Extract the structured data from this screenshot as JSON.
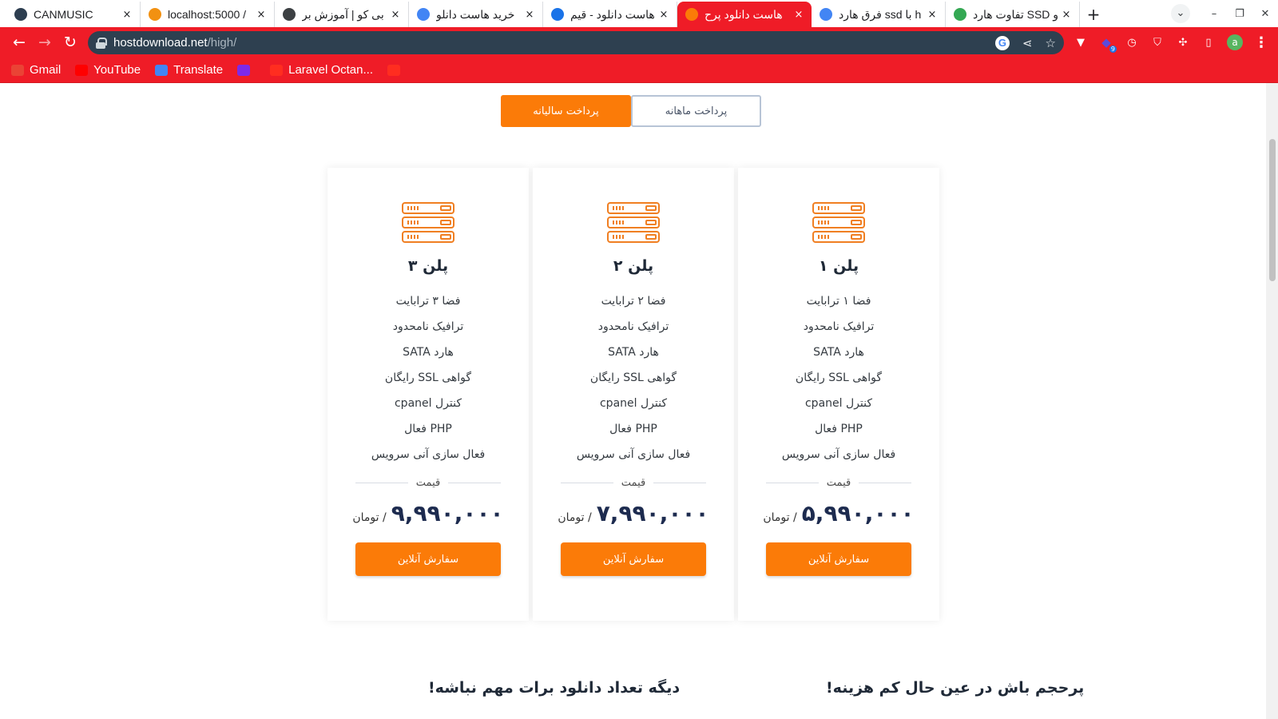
{
  "browser": {
    "tabs": [
      {
        "title": "CANMUSIC",
        "favicon_color": "#2d3e50",
        "active": false
      },
      {
        "title": "localhost:5000 /",
        "favicon_color": "#f29111",
        "active": false
      },
      {
        "title": "بی کو | آموزش بر",
        "favicon_color": "#3c4043",
        "active": false
      },
      {
        "title": "خرید هاست دانلو",
        "favicon_color": "#4285f4",
        "active": false
      },
      {
        "title": "هاست دانلود - قیم",
        "favicon_color": "#1a73e8",
        "active": false
      },
      {
        "title": "هاست دانلود پرح",
        "favicon_color": "#fb7b08",
        "active": true
      },
      {
        "title": "فرق هارد ssd با h",
        "favicon_color": "#4285f4",
        "active": false
      },
      {
        "title": "تفاوت هارد SSD و",
        "favicon_color": "#34a853",
        "active": false
      }
    ],
    "new_tab_label": "+",
    "close_label": "×",
    "url_host": "hostdownload.net",
    "url_path": "/high/",
    "bookmarks": [
      {
        "label": "Gmail",
        "icon": "gmail-icon",
        "color": "#ea4335"
      },
      {
        "label": "YouTube",
        "icon": "youtube-icon",
        "color": "#ff0000"
      },
      {
        "label": "Translate",
        "icon": "translate-icon",
        "color": "#4285f4"
      },
      {
        "label": "",
        "icon": "canva-icon",
        "color": "#7d2ae8"
      },
      {
        "label": "Laravel Octan...",
        "icon": "laravel-icon",
        "color": "#ff2d20"
      },
      {
        "label": "",
        "icon": "laravel-icon",
        "color": "#ff2d20"
      }
    ],
    "extension_badge": "9",
    "avatar_letter": "a"
  },
  "billing_toggle": {
    "yearly": "پرداخت سالیانه",
    "monthly": "پرداخت ماهانه",
    "selected": "yearly"
  },
  "plans": [
    {
      "title": "پلن ۳",
      "features": [
        "فضا ۳ ترابایت",
        "ترافیک نامحدود",
        "هارد SATA",
        "گواهی SSL رایگان",
        "کنترل cpanel",
        "PHP فعال",
        "فعال سازی آنی سرویس"
      ],
      "price_label": "قیمت",
      "price": "۹,۹۹۰,۰۰۰",
      "currency": "/ تومان",
      "order_label": "سفارش آنلاین"
    },
    {
      "title": "پلن ۲",
      "features": [
        "فضا ۲ ترابایت",
        "ترافیک نامحدود",
        "هارد SATA",
        "گواهی SSL رایگان",
        "کنترل cpanel",
        "PHP فعال",
        "فعال سازی آنی سرویس"
      ],
      "price_label": "قیمت",
      "price": "۷,۹۹۰,۰۰۰",
      "currency": "/ تومان",
      "order_label": "سفارش آنلاین"
    },
    {
      "title": "پلن ۱",
      "features": [
        "فضا ۱ ترابایت",
        "ترافیک نامحدود",
        "هارد SATA",
        "گواهی SSL رایگان",
        "کنترل cpanel",
        "PHP فعال",
        "فعال سازی آنی سرویس"
      ],
      "price_label": "قیمت",
      "price": "۵,۹۹۰,۰۰۰",
      "currency": "/ تومان",
      "order_label": "سفارش آنلاین"
    }
  ],
  "bottom": {
    "left_heading": "دیگه تعداد دانلود برات مهم نباشه!",
    "right_heading": "پرحجم باش در عین حال کم هزینه!"
  },
  "colors": {
    "browser_accent": "#ef1c27",
    "brand_orange": "#fb7b08",
    "omnibox": "#2e4050"
  }
}
